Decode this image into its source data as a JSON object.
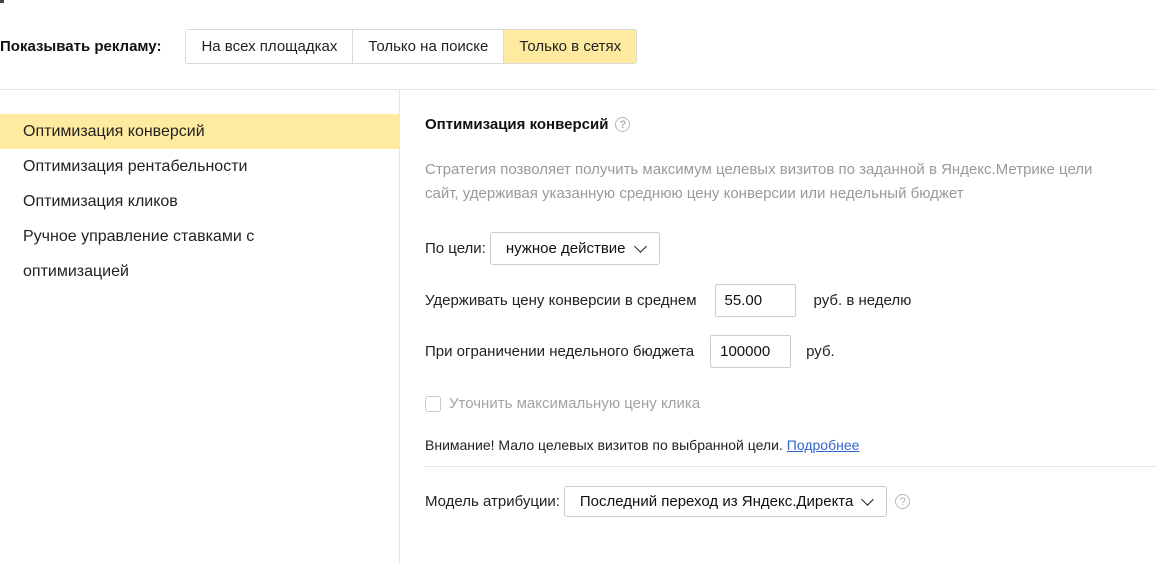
{
  "top": {
    "label": "Показывать рекламу:",
    "options": [
      "На всех площадках",
      "Только на поиске",
      "Только в сетях"
    ],
    "selected": "Только в сетях"
  },
  "sidebar": {
    "items": [
      {
        "label": "Оптимизация конверсий",
        "active": true
      },
      {
        "label": "Оптимизация рентабельности",
        "active": false
      },
      {
        "label": "Оптимизация кликов",
        "active": false
      },
      {
        "label_line1": "Ручное управление ставками с",
        "label_line2": "оптимизацией",
        "active": false
      }
    ]
  },
  "main": {
    "title": "Оптимизация конверсий",
    "help_icon": "question-circle-icon",
    "description_line1": "Стратегия позволяет получить максимум целевых визитов по заданной в Яндекс.Метрике цели",
    "description_line2": "сайт, удерживая указанную среднюю цену конверсии или недельный бюджет",
    "goal": {
      "label": "По цели:",
      "value": "нужное действие"
    },
    "avg_price": {
      "label": "Удерживать цену конверсии в среднем",
      "value": "55.00",
      "unit": "руб. в неделю"
    },
    "budget": {
      "label": "При ограничении недельного бюджета",
      "value": "100000",
      "unit": "руб."
    },
    "max_click": {
      "label": "Уточнить максимальную цену клика",
      "checked": false
    },
    "warning": {
      "text": "Внимание! Мало целевых визитов по выбранной цели.",
      "link": "Подробнее"
    },
    "attribution": {
      "label": "Модель атрибуции:",
      "value": "Последний переход из Яндекс.Директа"
    }
  },
  "colors": {
    "active_bg": "#ffeba0",
    "link": "#3366cc",
    "muted": "#9a9a9a",
    "border": "#cccccc"
  }
}
